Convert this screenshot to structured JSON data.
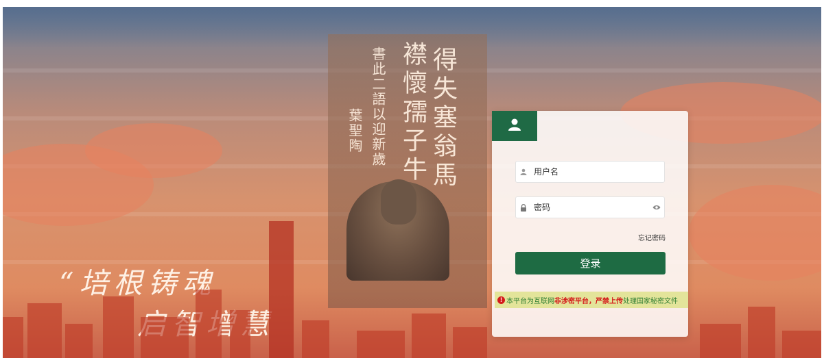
{
  "background": {
    "calligraphy_right_col1": "得失塞翁馬",
    "calligraphy_right_col2": "襟懷孺子牛",
    "calligraphy_left_col1": "書此二語以迎新歲",
    "calligraphy_left_col2": "葉聖陶",
    "slogan_line1": "“培根铸魂",
    "slogan_line2": "启智增慧"
  },
  "login": {
    "username_placeholder": "用户名",
    "password_placeholder": "密码",
    "forgot_password": "忘记密码",
    "login_button": "登录",
    "notice": {
      "part1": "本平台为互联网",
      "part2": "非涉密平台，严禁上传",
      "part3": "处理国家秘密文件"
    }
  },
  "colors": {
    "brand_green": "#1e6b43",
    "notice_bg": "#e3e49a",
    "warning_red": "#d41a1a"
  },
  "icons": {
    "avatar": "user-icon",
    "username": "user-icon",
    "password": "lock-icon",
    "visibility": "eye-icon",
    "warning": "warning-icon"
  }
}
